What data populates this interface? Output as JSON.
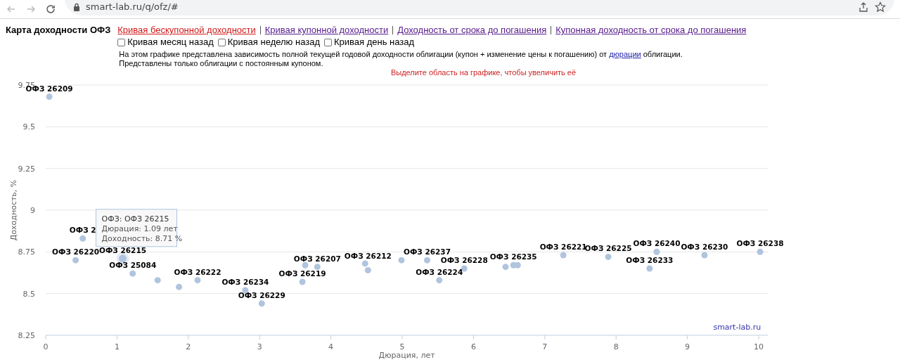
{
  "browser": {
    "url": "smart-lab.ru/q/ofz/#"
  },
  "page": {
    "title": "Карта доходности ОФЗ",
    "links": [
      {
        "label": "Кривая бескупонной доходности",
        "selected": true
      },
      {
        "label": "Кривая купонной доходности",
        "selected": false
      },
      {
        "label": "Доходность от срока до погашения",
        "selected": false
      },
      {
        "label": "Купонная доходность от срока до погашения",
        "selected": false
      }
    ],
    "checkboxes": [
      {
        "label": "Кривая месяц назад",
        "checked": false
      },
      {
        "label": "Кривая неделю назад",
        "checked": false
      },
      {
        "label": "Кривая день назад",
        "checked": false
      }
    ],
    "description": {
      "before": "На этом графике представлена зависимость полной текущей годовой доходности облигации (купон + изменение цены к погашению) от",
      "link": "дюрации",
      "after": "облигации.",
      "line2": "Представлены только облигации с постоянным купоном."
    },
    "hint": "Выделите область на графике, чтобы увеличить её"
  },
  "chart": {
    "chart_data": {
      "type": "scatter",
      "xlabel": "Дюрация, лет",
      "ylabel": "Доходность, %",
      "x": [
        0.05,
        0.42,
        0.52,
        1.08,
        1.22,
        1.57,
        1.87,
        2.13,
        2.8,
        3.03,
        3.6,
        3.64,
        3.81,
        4.48,
        4.52,
        4.99,
        5.35,
        5.52,
        5.87,
        6.45,
        6.56,
        6.62,
        7.26,
        7.89,
        8.47,
        8.57,
        9.24,
        10.02
      ],
      "series": [
        {
          "color": "#b0c4de",
          "values": [
            9.68,
            8.7,
            8.83,
            8.71,
            8.62,
            8.58,
            8.54,
            8.58,
            8.52,
            8.44,
            8.57,
            8.67,
            8.66,
            8.68,
            8.64,
            8.7,
            8.7,
            8.58,
            8.65,
            8.66,
            8.67,
            8.67,
            8.73,
            8.72,
            8.65,
            8.75,
            8.73,
            8.75
          ]
        }
      ],
      "grid": true,
      "xlim": [
        0,
        10.13
      ],
      "ylim": [
        8.25,
        9.75
      ],
      "xticks": [
        0,
        1,
        2,
        3,
        4,
        5,
        6,
        7,
        8,
        9,
        10
      ],
      "yticks": [
        8.25,
        8.5,
        8.75,
        9,
        9.25,
        9.5,
        9.75
      ],
      "annotations": [
        {
          "text": "ОФЗ 26209",
          "x": 0.05,
          "y": 9.68
        },
        {
          "text": "ОФЗ 26220",
          "x": 0.42,
          "y": 8.7
        },
        {
          "text": "ОФЗ 2",
          "x": 0.52,
          "y": 8.83
        },
        {
          "text": "ОФЗ 26215",
          "x": 1.08,
          "y": 8.71
        },
        {
          "text": "ОФЗ 25084",
          "x": 1.22,
          "y": 8.62
        },
        {
          "text": "ОФЗ 26222",
          "x": 2.13,
          "y": 8.58
        },
        {
          "text": "ОФЗ 26234",
          "x": 2.8,
          "y": 8.52
        },
        {
          "text": "ОФЗ 26229",
          "x": 3.03,
          "y": 8.44
        },
        {
          "text": "ОФЗ 26219",
          "x": 3.6,
          "y": 8.57
        },
        {
          "text": "ОФЗ 26207",
          "x": 3.81,
          "y": 8.66
        },
        {
          "text": "ОФЗ 26212",
          "x": 4.52,
          "y": 8.64
        },
        {
          "text": "ОФЗ 26237",
          "x": 5.35,
          "y": 8.7
        },
        {
          "text": "ОФЗ 26224",
          "x": 5.52,
          "y": 8.58
        },
        {
          "text": "ОФЗ 26228",
          "x": 5.87,
          "y": 8.65
        },
        {
          "text": "ОФЗ 26235",
          "x": 6.56,
          "y": 8.67
        },
        {
          "text": "ОФЗ 26221",
          "x": 7.26,
          "y": 8.73
        },
        {
          "text": "ОФЗ 26225",
          "x": 7.89,
          "y": 8.72
        },
        {
          "text": "ОФЗ 26233",
          "x": 8.47,
          "y": 8.65
        },
        {
          "text": "ОФЗ 26240",
          "x": 8.57,
          "y": 8.75
        },
        {
          "text": "ОФЗ 26230",
          "x": 9.24,
          "y": 8.73
        },
        {
          "text": "ОФЗ 26238",
          "x": 10.02,
          "y": 8.75
        }
      ]
    },
    "tooltip": {
      "title": "ОФЗ: ОФЗ 26215",
      "lines": [
        "Дюрация: 1.09 лет",
        "Доходность: 8.71 %"
      ]
    },
    "credit": "smart-lab.ru"
  }
}
